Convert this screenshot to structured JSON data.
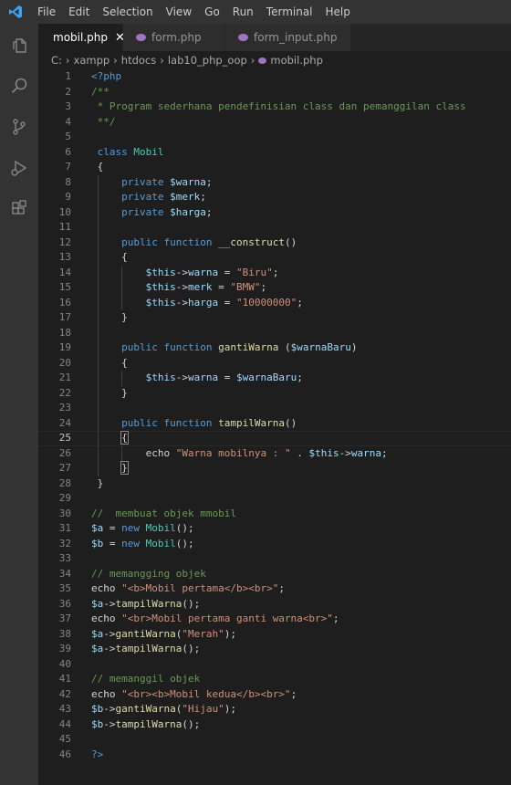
{
  "menu": [
    "File",
    "Edit",
    "Selection",
    "View",
    "Go",
    "Run",
    "Terminal",
    "Help"
  ],
  "tabs": [
    {
      "label": "mobil.php",
      "active": true
    },
    {
      "label": "form.php",
      "active": false
    },
    {
      "label": "form_input.php",
      "active": false
    }
  ],
  "breadcrumb": [
    "C:",
    "xampp",
    "htdocs",
    "lab10_php_oop",
    "mobil.php"
  ],
  "current_line": 25,
  "lines": [
    [
      [
        "k",
        "<?php"
      ]
    ],
    [
      [
        "c",
        "/**"
      ]
    ],
    [
      [
        "c",
        " * Program sederhana pendefinisian class dan pemanggilan class"
      ]
    ],
    [
      [
        "c",
        " **/"
      ]
    ],
    [],
    [
      [
        "p",
        " "
      ],
      [
        "k",
        "class"
      ],
      [
        "p",
        " "
      ],
      [
        "t",
        "Mobil"
      ]
    ],
    [
      [
        "p",
        " {"
      ]
    ],
    [
      [
        "p",
        "     "
      ],
      [
        "k",
        "private"
      ],
      [
        "p",
        " "
      ],
      [
        "v",
        "$warna"
      ],
      [
        "p",
        ";"
      ]
    ],
    [
      [
        "p",
        "     "
      ],
      [
        "k",
        "private"
      ],
      [
        "p",
        " "
      ],
      [
        "v",
        "$merk"
      ],
      [
        "p",
        ";"
      ]
    ],
    [
      [
        "p",
        "     "
      ],
      [
        "k",
        "private"
      ],
      [
        "p",
        " "
      ],
      [
        "v",
        "$harga"
      ],
      [
        "p",
        ";"
      ]
    ],
    [],
    [
      [
        "p",
        "     "
      ],
      [
        "k",
        "public"
      ],
      [
        "p",
        " "
      ],
      [
        "k",
        "function"
      ],
      [
        "p",
        " "
      ],
      [
        "f",
        "__construct"
      ],
      [
        "p",
        "()"
      ]
    ],
    [
      [
        "p",
        "     {"
      ]
    ],
    [
      [
        "p",
        "         "
      ],
      [
        "v",
        "$this"
      ],
      [
        "p",
        "->"
      ],
      [
        "v",
        "warna"
      ],
      [
        "p",
        " = "
      ],
      [
        "s",
        "\"Biru\""
      ],
      [
        "p",
        ";"
      ]
    ],
    [
      [
        "p",
        "         "
      ],
      [
        "v",
        "$this"
      ],
      [
        "p",
        "->"
      ],
      [
        "v",
        "merk"
      ],
      [
        "p",
        " = "
      ],
      [
        "s",
        "\"BMW\""
      ],
      [
        "p",
        ";"
      ]
    ],
    [
      [
        "p",
        "         "
      ],
      [
        "v",
        "$this"
      ],
      [
        "p",
        "->"
      ],
      [
        "v",
        "harga"
      ],
      [
        "p",
        " = "
      ],
      [
        "s",
        "\"10000000\""
      ],
      [
        "p",
        ";"
      ]
    ],
    [
      [
        "p",
        "     }"
      ]
    ],
    [],
    [
      [
        "p",
        "     "
      ],
      [
        "k",
        "public"
      ],
      [
        "p",
        " "
      ],
      [
        "k",
        "function"
      ],
      [
        "p",
        " "
      ],
      [
        "f",
        "gantiWarna"
      ],
      [
        "p",
        " ("
      ],
      [
        "v",
        "$warnaBaru"
      ],
      [
        "p",
        ")"
      ]
    ],
    [
      [
        "p",
        "     {"
      ]
    ],
    [
      [
        "p",
        "         "
      ],
      [
        "v",
        "$this"
      ],
      [
        "p",
        "->"
      ],
      [
        "v",
        "warna"
      ],
      [
        "p",
        " = "
      ],
      [
        "v",
        "$warnaBaru"
      ],
      [
        "p",
        ";"
      ]
    ],
    [
      [
        "p",
        "     }"
      ]
    ],
    [],
    [
      [
        "p",
        "     "
      ],
      [
        "k",
        "public"
      ],
      [
        "p",
        " "
      ],
      [
        "k",
        "function"
      ],
      [
        "p",
        " "
      ],
      [
        "f",
        "tampilWarna"
      ],
      [
        "p",
        "()"
      ]
    ],
    [
      [
        "p",
        "     "
      ],
      [
        "br",
        "{"
      ]
    ],
    [
      [
        "p",
        "         "
      ],
      [
        "p",
        "echo "
      ],
      [
        "s",
        "\"Warna mobilnya : \""
      ],
      [
        "p",
        " . "
      ],
      [
        "v",
        "$this"
      ],
      [
        "p",
        "->"
      ],
      [
        "v",
        "warna"
      ],
      [
        "p",
        ";"
      ]
    ],
    [
      [
        "p",
        "     "
      ],
      [
        "br",
        "}"
      ]
    ],
    [
      [
        "p",
        " }"
      ]
    ],
    [],
    [
      [
        "c",
        "//  membuat objek mmobil"
      ]
    ],
    [
      [
        "v",
        "$a"
      ],
      [
        "p",
        " = "
      ],
      [
        "k",
        "new"
      ],
      [
        "p",
        " "
      ],
      [
        "t",
        "Mobil"
      ],
      [
        "p",
        "();"
      ]
    ],
    [
      [
        "v",
        "$b"
      ],
      [
        "p",
        " = "
      ],
      [
        "k",
        "new"
      ],
      [
        "p",
        " "
      ],
      [
        "t",
        "Mobil"
      ],
      [
        "p",
        "();"
      ]
    ],
    [],
    [
      [
        "c",
        "// memangging objek"
      ]
    ],
    [
      [
        "p",
        "echo "
      ],
      [
        "s",
        "\"<b>Mobil pertama</b><br>\""
      ],
      [
        "p",
        ";"
      ]
    ],
    [
      [
        "v",
        "$a"
      ],
      [
        "p",
        "->"
      ],
      [
        "f",
        "tampilWarna"
      ],
      [
        "p",
        "();"
      ]
    ],
    [
      [
        "p",
        "echo "
      ],
      [
        "s",
        "\"<br>Mobil pertama ganti warna<br>\""
      ],
      [
        "p",
        ";"
      ]
    ],
    [
      [
        "v",
        "$a"
      ],
      [
        "p",
        "->"
      ],
      [
        "f",
        "gantiWarna"
      ],
      [
        "p",
        "("
      ],
      [
        "s",
        "\"Merah\""
      ],
      [
        "p",
        ");"
      ]
    ],
    [
      [
        "v",
        "$a"
      ],
      [
        "p",
        "->"
      ],
      [
        "f",
        "tampilWarna"
      ],
      [
        "p",
        "();"
      ]
    ],
    [],
    [
      [
        "c",
        "// memanggil objek"
      ]
    ],
    [
      [
        "p",
        "echo "
      ],
      [
        "s",
        "\"<br><b>Mobil kedua</b><br>\""
      ],
      [
        "p",
        ";"
      ]
    ],
    [
      [
        "v",
        "$b"
      ],
      [
        "p",
        "->"
      ],
      [
        "f",
        "gantiWarna"
      ],
      [
        "p",
        "("
      ],
      [
        "s",
        "\"Hijau\""
      ],
      [
        "p",
        ");"
      ]
    ],
    [
      [
        "v",
        "$b"
      ],
      [
        "p",
        "->"
      ],
      [
        "f",
        "tampilWarna"
      ],
      [
        "p",
        "();"
      ]
    ],
    [],
    [
      [
        "k",
        "?>"
      ]
    ]
  ]
}
